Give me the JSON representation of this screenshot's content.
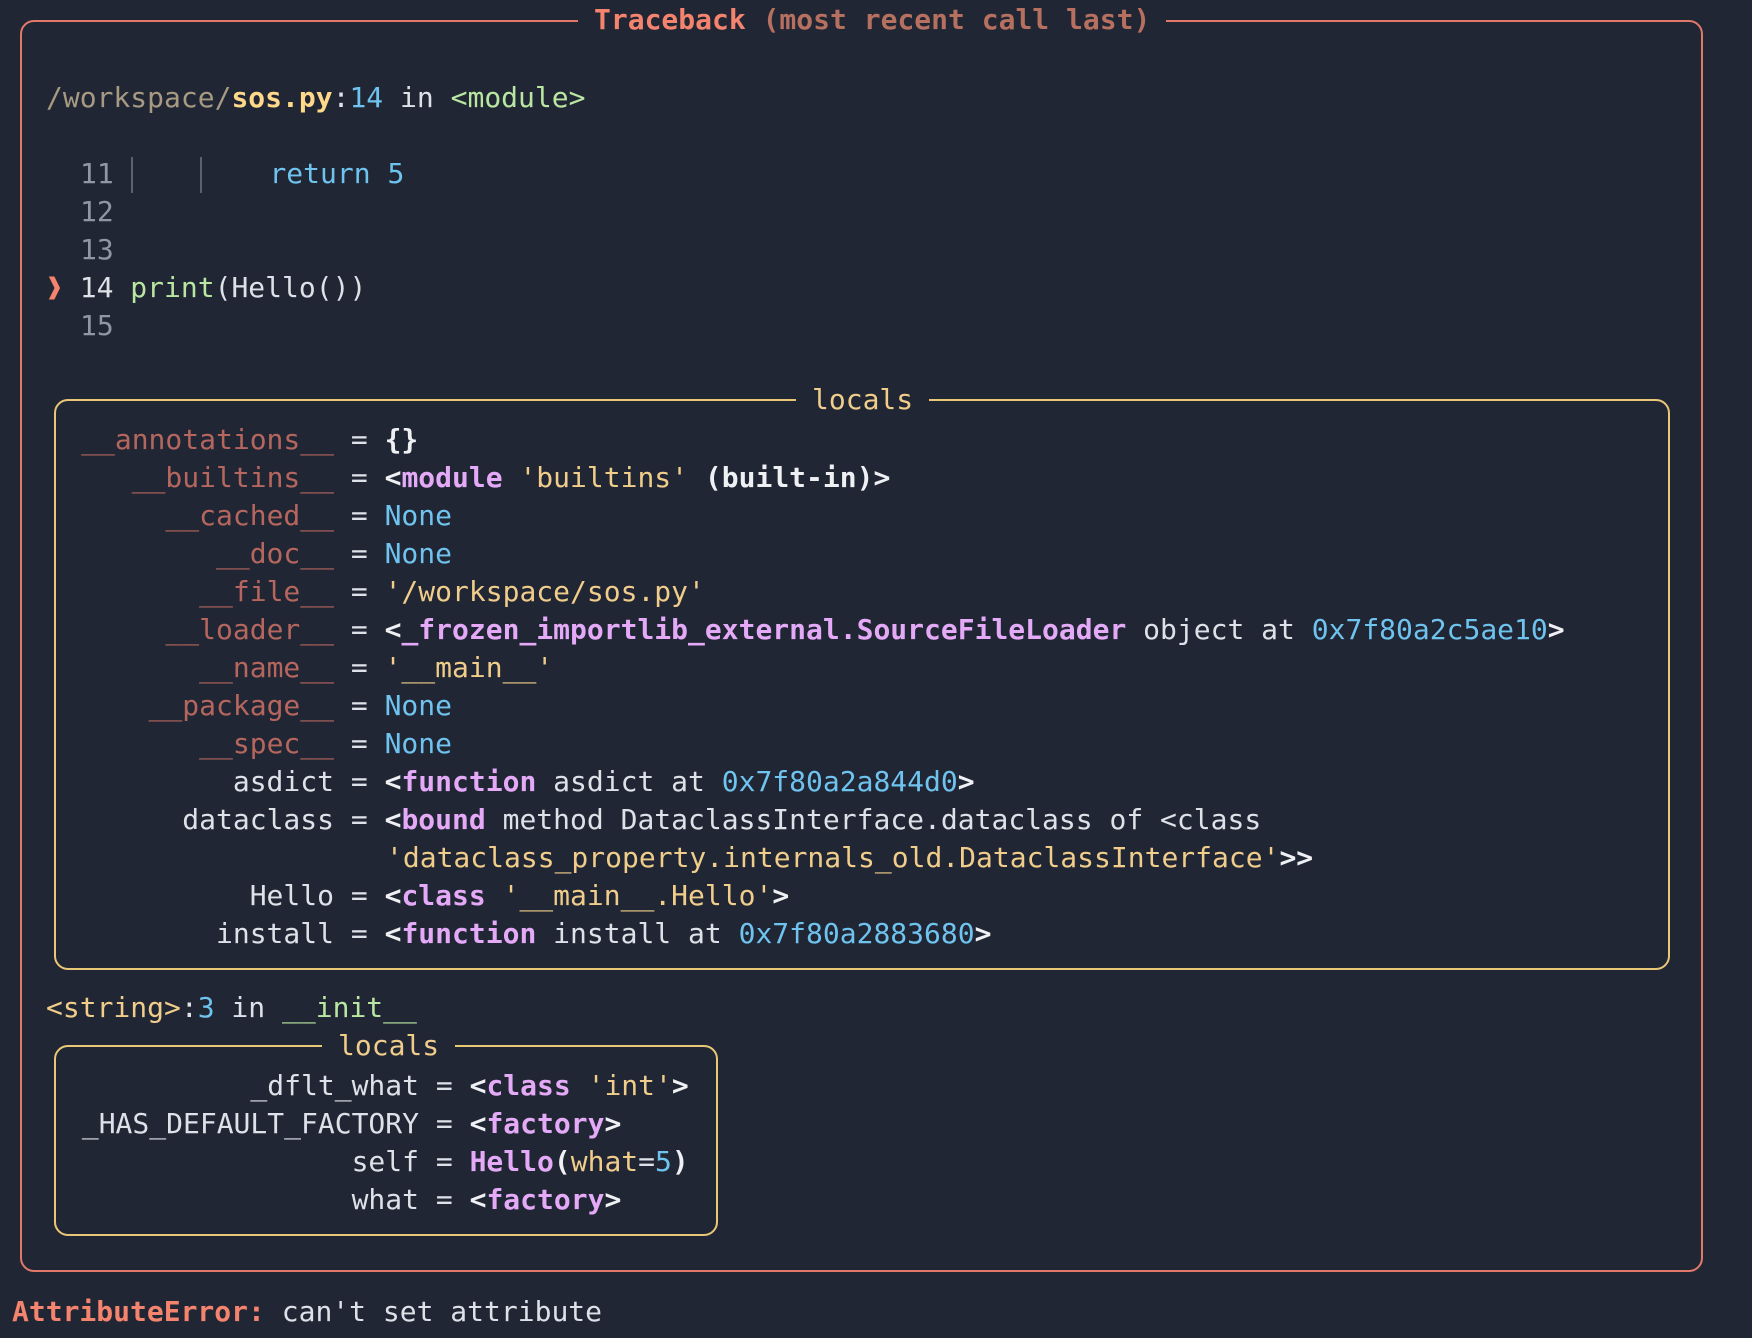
{
  "traceback": {
    "title_main": "Traceback",
    "title_sub": "(most recent call last)",
    "frame1": {
      "path_prefix": "/workspace/",
      "filename": "sos.py",
      "sep": ":",
      "lineno": "14",
      "in_text": " in ",
      "func": "<module>",
      "code_lines": [
        {
          "num": "11",
          "code_kw": "return",
          "code_val": "5"
        },
        {
          "num": "12"
        },
        {
          "num": "13"
        },
        {
          "num": "14",
          "arrow": "❱",
          "code_fn": "print",
          "code_rest": "(Hello())"
        },
        {
          "num": "15"
        }
      ],
      "locals_title": "locals",
      "locals": [
        {
          "key": "__annotations__",
          "eq": " = ",
          "v1": "{}"
        },
        {
          "key": "__builtins__",
          "eq": " = ",
          "lt": "<",
          "kw": "module",
          "str": " 'builtins' ",
          "rest": "(built-in)>"
        },
        {
          "key": "__cached__",
          "eq": " = ",
          "v1": "None"
        },
        {
          "key": "__doc__",
          "eq": " = ",
          "v1": "None"
        },
        {
          "key": "__file__",
          "eq": " = ",
          "v1": "'/workspace/sos.py'"
        },
        {
          "key": "__loader__",
          "eq": " = ",
          "lt": "<",
          "kw": "_frozen_importlib_external.SourceFileLoader",
          "plain": " object at ",
          "addr": "0x7f80a2c5ae10",
          "gt": ">"
        },
        {
          "key": "__name__",
          "eq": " = ",
          "v1": "'__main__'"
        },
        {
          "key": "__package__",
          "eq": " = ",
          "v1": "None"
        },
        {
          "key": "__spec__",
          "eq": " = ",
          "v1": "None"
        },
        {
          "key": "asdict",
          "eq": " = ",
          "lt": "<",
          "kw": "function",
          "plain": " asdict at ",
          "addr": "0x7f80a2a844d0",
          "gt": ">"
        },
        {
          "key": "dataclass",
          "eq": " = ",
          "lt": "<",
          "kw": "bound",
          "plain": " method DataclassInterface.dataclass of <class",
          "cont_str": "'dataclass_property.internals_old.DataclassInterface'",
          "cont_gt": ">>"
        },
        {
          "key": "Hello",
          "eq": " = ",
          "lt": "<",
          "kw": "class",
          "str": " '__main__.Hello'",
          "gt": ">"
        },
        {
          "key": "install",
          "eq": " = ",
          "lt": "<",
          "kw": "function",
          "plain": " install at ",
          "addr": "0x7f80a2883680",
          "gt": ">"
        }
      ]
    },
    "frame2": {
      "location": "<string>",
      "sep": ":",
      "lineno": "3",
      "in_text": " in ",
      "func": "__init__",
      "locals_title": "locals",
      "locals": [
        {
          "key": "_dflt_what",
          "eq": " = ",
          "lt": "<",
          "kw": "class",
          "str": " 'int'",
          "gt": ">"
        },
        {
          "key": "_HAS_DEFAULT_FACTORY",
          "eq": " = ",
          "lt": "<",
          "kw": "factory",
          "gt": ">"
        },
        {
          "key": "self",
          "eq": " = ",
          "obj": "Hello",
          "paren_open": "(",
          "attr": "what",
          "assign": "=",
          "num": "5",
          "paren_close": ")"
        },
        {
          "key": "what",
          "eq": " = ",
          "lt": "<",
          "kw": "factory",
          "gt": ">"
        }
      ]
    }
  },
  "error": {
    "type": "AttributeError:",
    "message": " can't set attribute"
  },
  "colors": {
    "background": "#212634",
    "frame_border": "#e0796a",
    "locals_border": "#e9c777",
    "error_red": "#f4846d"
  }
}
